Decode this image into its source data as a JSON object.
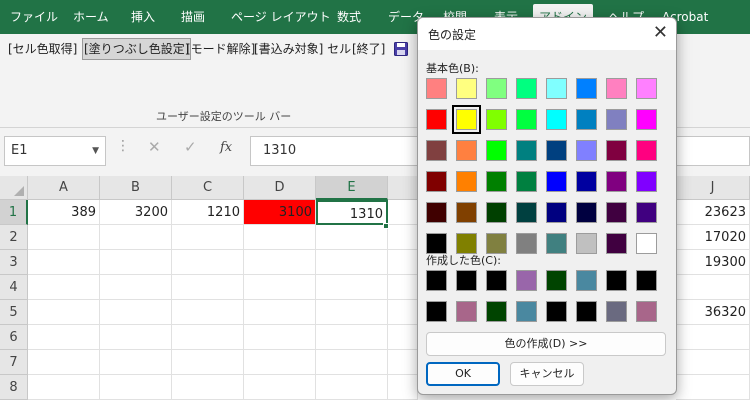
{
  "ribbon": {
    "tabs": [
      {
        "label": "ファイル",
        "active": false
      },
      {
        "label": "ホーム",
        "active": false
      },
      {
        "label": "挿入",
        "active": false
      },
      {
        "label": "描画",
        "active": false
      },
      {
        "label": "ページ レイアウト",
        "active": false
      },
      {
        "label": "数式",
        "active": false
      },
      {
        "label": "データ",
        "active": false
      },
      {
        "label": "校閲",
        "active": false
      },
      {
        "label": "表示",
        "active": false
      },
      {
        "label": "アドイン",
        "active": true
      },
      {
        "label": "ヘルプ",
        "active": false
      },
      {
        "label": "Acrobat",
        "active": false
      }
    ],
    "toolbar_items": [
      {
        "label": "[セル色取得]",
        "pressed": false
      },
      {
        "label": "[塗りつぶし色設定]",
        "pressed": true
      },
      {
        "label": "[モード解除]",
        "pressed": false
      },
      {
        "label": "[書込み対象] セル",
        "pressed": false
      },
      {
        "label": "[終了]",
        "pressed": false
      }
    ],
    "save_icon": "floppy-disk-icon",
    "group_label": "ユーザー設定のツール バー",
    "accent_color": "#217346"
  },
  "formula_bar": {
    "name_box": "E1",
    "cancel_icon": "✕",
    "enter_icon": "✓",
    "fx_label": "fx",
    "formula_value": "1310"
  },
  "sheet": {
    "columns": [
      "A",
      "B",
      "C",
      "D",
      "E",
      "J"
    ],
    "selected_column": "E",
    "rows": [
      "1",
      "2",
      "3",
      "4",
      "5",
      "6",
      "7",
      "8"
    ],
    "selected_row": "1",
    "row1": [
      "389",
      "3200",
      "1210",
      "3100",
      "1310"
    ],
    "column_j": [
      "23623",
      "17020",
      "19300",
      "",
      "36320",
      "",
      "",
      ""
    ],
    "red_cell_color": "#ff0000"
  },
  "dialog": {
    "title": "色の設定",
    "close_icon": "✕",
    "basic_colors_label": "基本色(B):",
    "custom_colors_label": "作成した色(C):",
    "define_button": "色の作成(D) >>",
    "ok_button": "OK",
    "cancel_button": "キャンセル",
    "selected_basic_index": 9,
    "basic_colors": [
      "#ff8080",
      "#ffff80",
      "#80ff80",
      "#00ff80",
      "#80ffff",
      "#0080ff",
      "#ff80c0",
      "#ff80ff",
      "#ff0000",
      "#ffff00",
      "#80ff00",
      "#00ff40",
      "#00ffff",
      "#0080c0",
      "#8080c0",
      "#ff00ff",
      "#804040",
      "#ff8040",
      "#00ff00",
      "#008080",
      "#004080",
      "#8080ff",
      "#800040",
      "#ff0080",
      "#800000",
      "#ff8000",
      "#008000",
      "#008040",
      "#0000ff",
      "#0000a0",
      "#800080",
      "#8000ff",
      "#400000",
      "#804000",
      "#004000",
      "#004040",
      "#000080",
      "#000040",
      "#400040",
      "#400080",
      "#000000",
      "#808000",
      "#808040",
      "#808080",
      "#408080",
      "#c0c0c0",
      "#400040",
      "#ffffff"
    ],
    "custom_colors": [
      "#000000",
      "#000000",
      "#000000",
      "#9966aa",
      "#004400",
      "#4a88a0",
      "#000000",
      "#000000",
      "#000000",
      "#a8668a",
      "#004400",
      "#4a88a0",
      "#000000",
      "#000000",
      "#6a6a80",
      "#a8668a"
    ]
  }
}
